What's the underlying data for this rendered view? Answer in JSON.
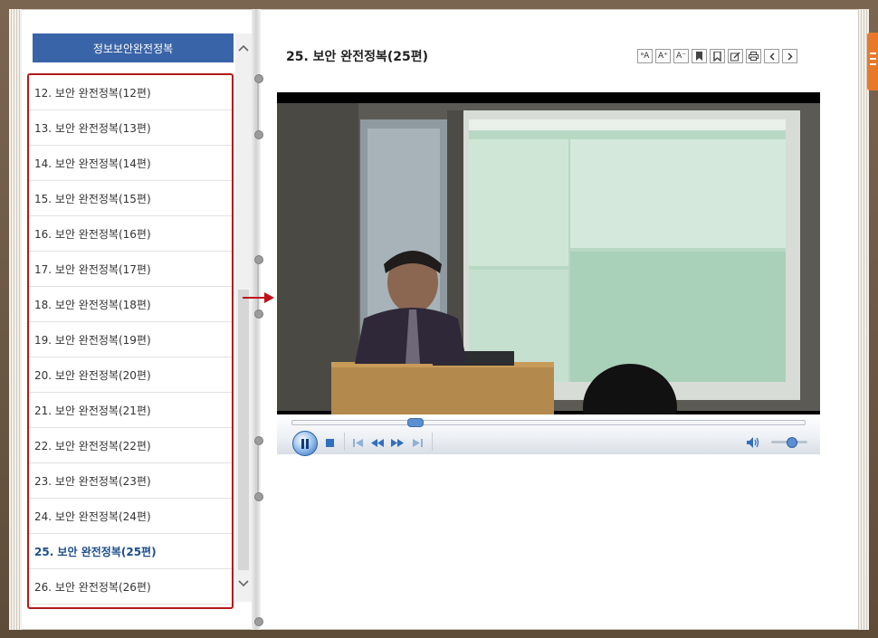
{
  "sidebar": {
    "category": "정보보안완전정복",
    "chapters": [
      "12. 보안 완전정복(12편)",
      "13. 보안 완전정복(13편)",
      "14. 보안 완전정복(14편)",
      "15. 보안 완전정복(15편)",
      "16. 보안 완전정복(16편)",
      "17. 보안 완전정복(17편)",
      "18. 보안 완전정복(18편)",
      "19. 보안 완전정복(19편)",
      "20. 보안 완전정복(20편)",
      "21. 보안 완전정복(21편)",
      "22. 보안 완전정복(22편)",
      "23. 보안 완전정복(23편)",
      "24. 보안 완전정복(24편)",
      "25. 보안 완전정복(25편)",
      "26. 보안 완전정복(26편)"
    ],
    "active_index": 13
  },
  "content": {
    "title": "25. 보안 완전정복(25편)"
  },
  "toolbar": {
    "font_reset": "ᵃA",
    "font_increase": "A⁺",
    "font_decrease": "A⁻"
  },
  "player": {
    "seek_progress": 0.24,
    "volume": 0.55
  },
  "colors": {
    "header_bg": "#3a64a8",
    "highlight_border": "#b21b1b",
    "active_text": "#1c4d8c",
    "accent_tab": "#e8792b"
  }
}
